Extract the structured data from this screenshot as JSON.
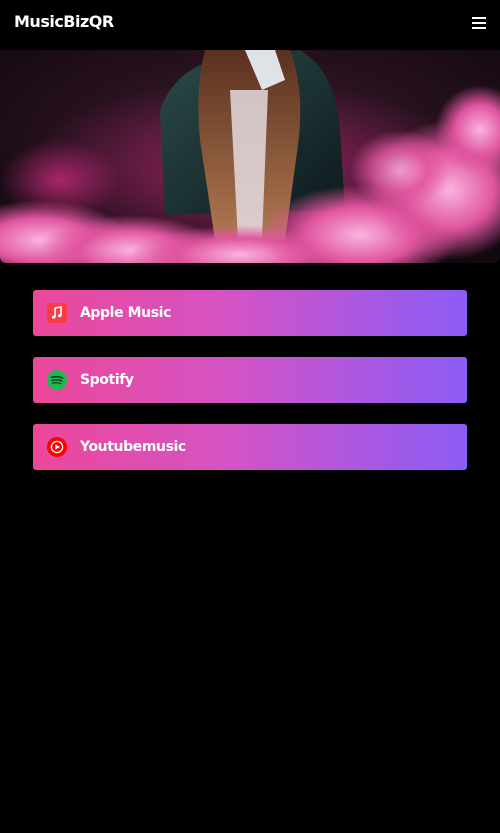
{
  "header": {
    "logo_text": "MusicBizQR",
    "menu_icon": "hamburger-menu-icon"
  },
  "hero": {
    "image_subject": "woman in leather jacket in pink smoke"
  },
  "links": [
    {
      "label": "Apple Music",
      "icon": "apple-music-icon",
      "icon_color": "#fc3c44"
    },
    {
      "label": "Spotify",
      "icon": "spotify-icon",
      "icon_color": "#1db954"
    },
    {
      "label": "Youtubemusic",
      "icon": "youtube-music-icon",
      "icon_color": "#ff0000"
    }
  ],
  "colors": {
    "background": "#000000",
    "button_gradient_start": "#ec4899",
    "button_gradient_end": "#8b5cf6",
    "text": "#ffffff"
  }
}
